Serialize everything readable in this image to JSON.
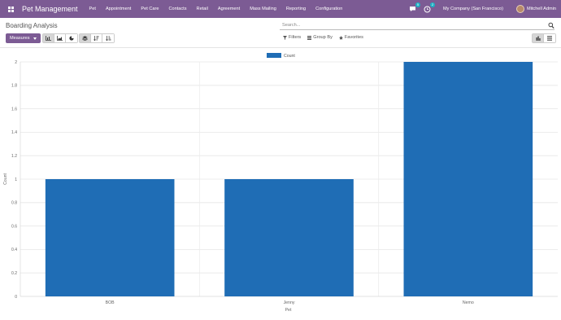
{
  "navbar": {
    "brand": "Pet Management",
    "menu": [
      "Pet",
      "Appointment",
      "Pet Care",
      "Contacts",
      "Retail",
      "Agreement",
      "Mass Mailing",
      "Reporting",
      "Configuration"
    ],
    "messages_badge": "5",
    "activity_badge": "2",
    "company": "My Company (San Francisco)",
    "user": "Mitchell Admin"
  },
  "control_panel": {
    "title": "Boarding Analysis",
    "search_placeholder": "Search...",
    "measures_label": "Measures",
    "filters_label": "Filters",
    "group_by_label": "Group By",
    "favorites_label": "Favorites"
  },
  "chart_data": {
    "type": "bar",
    "categories": [
      "BOB",
      "Jenny",
      "Nemo"
    ],
    "series": [
      {
        "name": "Count",
        "values": [
          1,
          1,
          2
        ],
        "color": "#1f6db5"
      }
    ],
    "xlabel": "Pet",
    "ylabel": "Count",
    "ylim": [
      0,
      2
    ],
    "yticks": [
      "0",
      "0.2",
      "0.4",
      "0.6",
      "0.8",
      "1",
      "1.2",
      "1.4",
      "1.6",
      "1.8",
      "2"
    ],
    "grid": true,
    "legend_position": "top"
  }
}
